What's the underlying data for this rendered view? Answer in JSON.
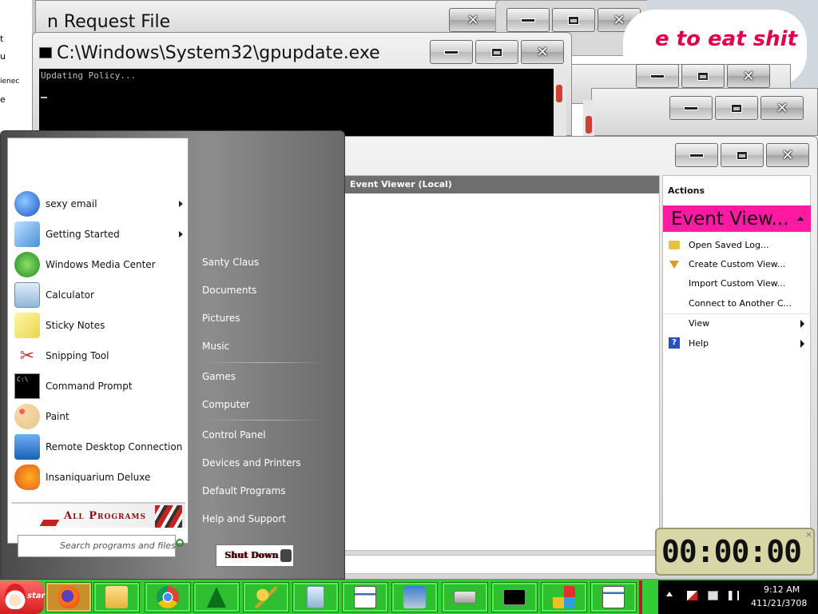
{
  "windows": {
    "request_file": {
      "title": "n Request File"
    },
    "gpupdate": {
      "title": "C:\\Windows\\System32\\gpupdate.exe",
      "console_text": "Updating Policy..."
    },
    "popup": {
      "text": "e to eat shit"
    },
    "event_viewer": {
      "tree_header": "Event Viewer (Local)",
      "actions_header": "Actions",
      "actions_title": "Event View...",
      "actions": [
        {
          "label": "Open Saved Log...",
          "icon": "folder-open-icon"
        },
        {
          "label": "Create Custom View...",
          "icon": "filter-icon"
        },
        {
          "label": "Import Custom View...",
          "icon": ""
        },
        {
          "label": "Connect to Another C...",
          "icon": ""
        },
        {
          "label": "View",
          "icon": "",
          "submenu": true
        },
        {
          "label": "Help",
          "icon": "help-icon",
          "submenu": true
        }
      ]
    },
    "left_edge_fragments": [
      "t",
      "u",
      "ienec",
      "e"
    ]
  },
  "start_menu": {
    "programs": [
      {
        "label": "sexy email",
        "icon": "thunderbird-icon",
        "submenu": true
      },
      {
        "label": "Getting Started",
        "icon": "getting-started-icon",
        "submenu": true
      },
      {
        "label": "Windows Media Center",
        "icon": "media-center-icon"
      },
      {
        "label": "Calculator",
        "icon": "calculator-icon"
      },
      {
        "label": "Sticky Notes",
        "icon": "sticky-notes-icon"
      },
      {
        "label": "Snipping Tool",
        "icon": "scissors-icon"
      },
      {
        "label": "Command Prompt",
        "icon": "cmd-icon"
      },
      {
        "label": "Paint",
        "icon": "paint-palette-icon"
      },
      {
        "label": "Remote Desktop Connection",
        "icon": "remote-desktop-icon"
      },
      {
        "label": "Insaniquarium Deluxe",
        "icon": "fish-icon"
      }
    ],
    "all_programs": "All Programs",
    "search_placeholder": "Search programs and files",
    "right_links": [
      "Santy Claus",
      "Documents",
      "Pictures",
      "Music",
      "Games",
      "Computer",
      "Control Panel",
      "Devices and Printers",
      "Default Programs",
      "Help and Support"
    ],
    "shutdown_label": "Shut Down"
  },
  "timer": {
    "display": "00:00:00",
    "close": "×"
  },
  "taskbar": {
    "start_label": "start",
    "buttons": [
      "firefox-icon",
      "explorer-icon",
      "chrome-icon",
      "christmas-tree-icon",
      "keys-icon",
      "calculator-icon",
      "event-viewer-icon",
      "network-printer-icon",
      "drive-icon",
      "cmd-icon",
      "games-icon",
      "window-icon"
    ],
    "clock_time": "9:12 AM",
    "clock_date": "411/21/3708",
    "colors": {
      "bar": "#33cc33",
      "accent": "#ff1aa3"
    }
  }
}
